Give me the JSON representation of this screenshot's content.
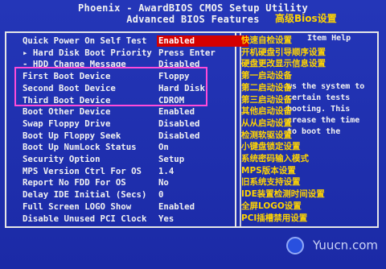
{
  "header": {
    "title_line1": "Phoenix - AwardBIOS CMOS Setup Utility",
    "title_line2": "Advanced BIOS Features",
    "chinese_title": "高级Bios设置"
  },
  "left_items": [
    {
      "label": "Quick Power On Self Test",
      "value": "Enabled",
      "selected": true
    },
    {
      "label": "▸ Hard Disk Boot Priority",
      "value": "Press Enter",
      "selected": false
    },
    {
      "label": "- HDD Change Message",
      "value": "Disabled",
      "selected": false
    },
    {
      "label": "First Boot Device",
      "value": "Floppy",
      "selected": false
    },
    {
      "label": "Second Boot Device",
      "value": "Hard Disk",
      "selected": false
    },
    {
      "label": "Third Boot Device",
      "value": "CDROM",
      "selected": false
    },
    {
      "label": "Boot Other Device",
      "value": "Enabled",
      "selected": false
    },
    {
      "label": "Swap Floppy Drive",
      "value": "Disabled",
      "selected": false
    },
    {
      "label": "Boot Up Floppy Seek",
      "value": "Disabled",
      "selected": false
    },
    {
      "label": "Boot Up NumLock Status",
      "value": "On",
      "selected": false
    },
    {
      "label": "Security Option",
      "value": "Setup",
      "selected": false
    },
    {
      "label": "MPS Version Ctrl For OS",
      "value": "1.4",
      "selected": false
    },
    {
      "label": "Report No FDD For OS",
      "value": "No",
      "selected": false
    },
    {
      "label": "Delay IDE Initial (Secs)",
      "value": "0",
      "selected": false
    },
    {
      "label": "Full Screen LOGO Show",
      "value": "Enabled",
      "selected": false
    },
    {
      "label": "Disable Unused PCI Clock",
      "value": "Yes",
      "selected": false
    }
  ],
  "help": {
    "item_help": "Item Help",
    "lines": [
      "ws the system to",
      "certain tests",
      "booting. This",
      "crease the time",
      "to boot the"
    ]
  },
  "annotations": [
    "快速自检设置",
    "开机硬盘引导顺序设置",
    "硬盘更改显示信息设置",
    "第一启动设备",
    "第二启动设备",
    "第三启动设备",
    "其他启动设备",
    "从从启动设置",
    "检测软驱设置",
    "小键盘锁定设置",
    "系统密码输入模式",
    "MPS版本设置",
    "旧系统支持设置",
    "IDE装置检测时间设置",
    "全屏LOGO设置",
    "PCI插槽禁用设置"
  ],
  "watermark": "Yuucn.com"
}
